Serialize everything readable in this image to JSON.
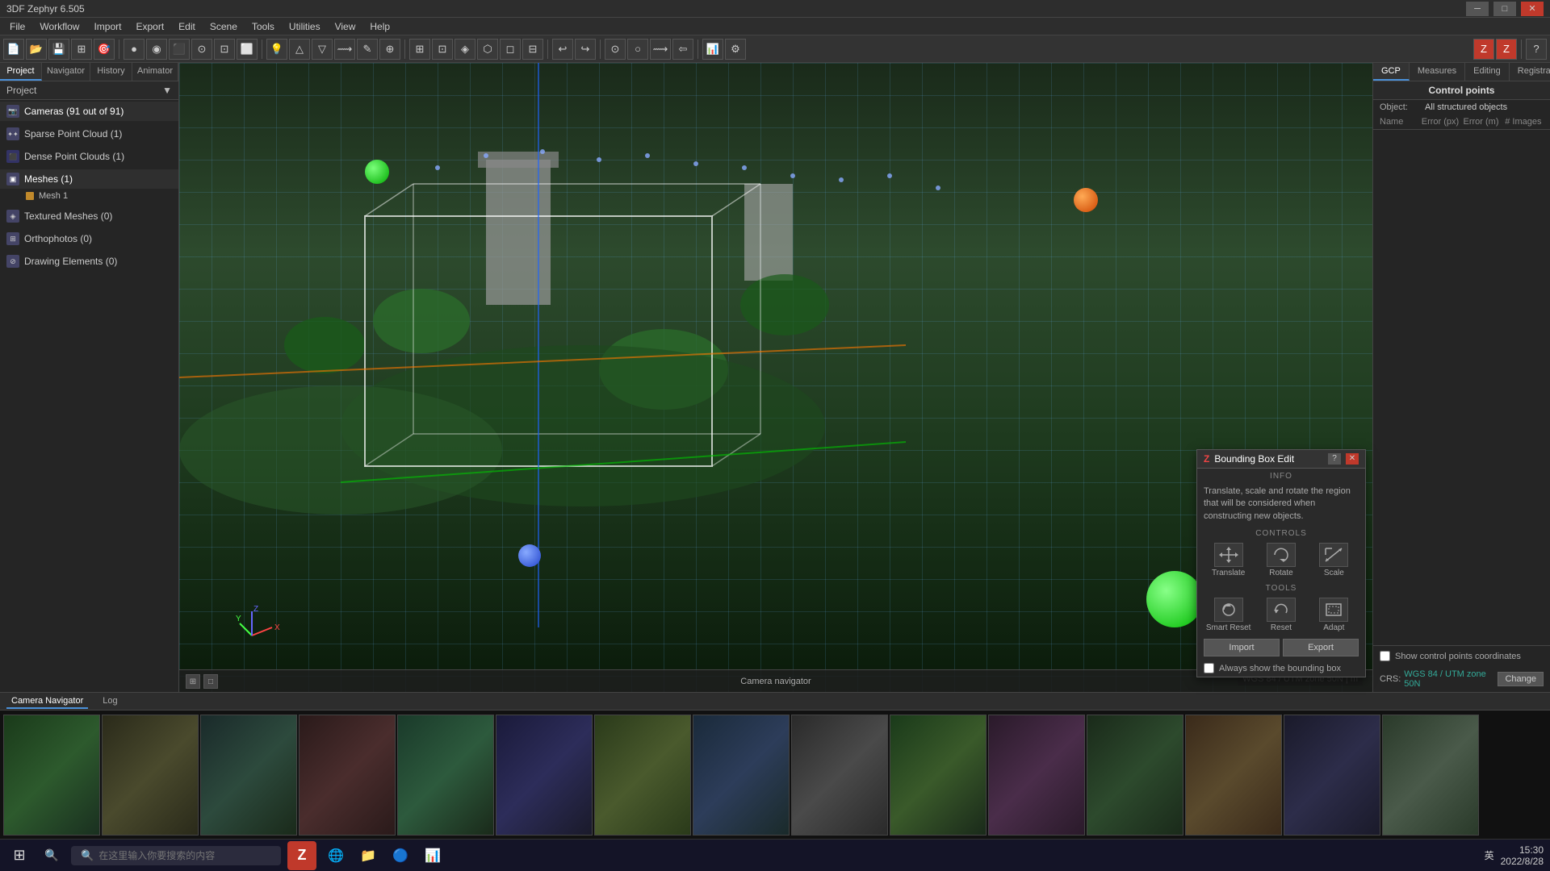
{
  "app": {
    "title": "3DF Zephyr 6.505",
    "version": "6.505"
  },
  "titlebar": {
    "title": "3DF Zephyr 6.505",
    "minimize": "─",
    "maximize": "□",
    "close": "✕"
  },
  "menubar": {
    "items": [
      "File",
      "Workflow",
      "Import",
      "Export",
      "Edit",
      "Scene",
      "Tools",
      "Utilities",
      "View",
      "Help"
    ]
  },
  "sidebar": {
    "tabs": [
      "Project",
      "Navigator",
      "History",
      "Animator"
    ],
    "active_tab": "Project",
    "title": "Project",
    "sections": [
      {
        "id": "cameras",
        "label": "Cameras (91 out of 91)",
        "icon": "📷",
        "expanded": true
      },
      {
        "id": "sparse",
        "label": "Sparse Point Cloud (1)",
        "icon": "✦"
      },
      {
        "id": "dense",
        "label": "Dense Point Clouds (1)",
        "icon": "⬛"
      },
      {
        "id": "meshes",
        "label": "Meshes (1)",
        "icon": "▣",
        "expanded": true
      },
      {
        "id": "mesh1",
        "label": "Mesh 1",
        "child": true
      },
      {
        "id": "textured",
        "label": "Textured Meshes (0)",
        "icon": "◈"
      },
      {
        "id": "ortho",
        "label": "Orthophotos (0)",
        "icon": "⊞"
      },
      {
        "id": "drawing",
        "label": "Drawing Elements (0)",
        "icon": "⊘"
      }
    ]
  },
  "viewport": {
    "coordinate_system": "WGS 84 / UTM zone 50N",
    "unit": "m",
    "status_text": "WGS 84 / UTM zone 50N | m",
    "bottom_label": "Camera navigator"
  },
  "bottom_tabs": [
    {
      "label": "Camera Navigator",
      "active": true
    },
    {
      "label": "Log",
      "active": false
    }
  ],
  "right_panel": {
    "tabs": [
      "GCP",
      "Measures",
      "Editing",
      "Registration"
    ],
    "active_tab": "GCP",
    "header": "Control points",
    "object_label": "Object:",
    "object_value": "All structured objects",
    "col_headers": [
      "Name",
      "Error (px)",
      "Error (m)",
      "# Images"
    ],
    "show_coordinates_label": "Show control points coordinates",
    "crs_label": "CRS:",
    "crs_value": "WGS 84 / UTM zone 50N",
    "change_btn": "Change"
  },
  "bbox_dialog": {
    "title": "Bounding Box Edit",
    "help_btn": "?",
    "close_btn": "✕",
    "info_section": "INFO",
    "description": "Translate, scale and rotate the region that will be considered when constructing new objects.",
    "controls_section": "CONTROLS",
    "controls": [
      {
        "label": "Translate",
        "icon": "⊕"
      },
      {
        "label": "Rotate",
        "icon": "↻"
      },
      {
        "label": "Scale",
        "icon": "⤢"
      }
    ],
    "tools_section": "TOOLS",
    "tools": [
      {
        "label": "Smart Reset",
        "icon": "⟳"
      },
      {
        "label": "Reset",
        "icon": "↺"
      },
      {
        "label": "Adapt",
        "icon": "⊡"
      }
    ],
    "import_btn": "Import",
    "export_btn": "Export",
    "always_show_label": "Always show the bounding box"
  },
  "taskbar": {
    "search_placeholder": "在这里输入你要搜索的内容",
    "time": "15:30",
    "date": "2022/8/28",
    "lang": "英"
  },
  "icons": {
    "zephyr_icon": "Z",
    "windows_icon": "⊞",
    "search_icon": "🔍",
    "edge_icon": "e",
    "folder_icon": "📁",
    "blender_icon": "B"
  }
}
